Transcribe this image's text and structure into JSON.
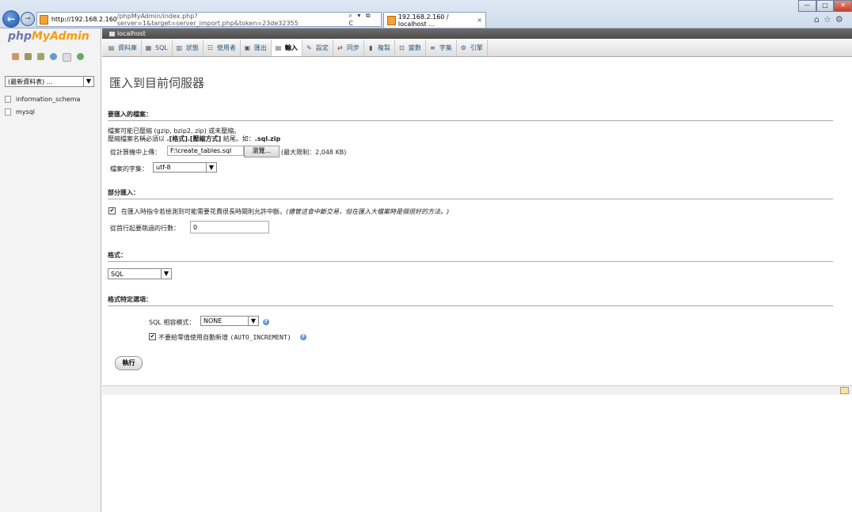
{
  "browser": {
    "url_host": "http://192.168.2.160",
    "url_path": "/phpMyAdmin/index.php?server=1&target=server_import.php&token=23de32355",
    "url_controls": "⌕ ▾ ⧉ C",
    "tab_title": "192.168.2.160 / localhost ...",
    "tab_close": "×",
    "right_icons": "⌂☆⚙"
  },
  "sidebar": {
    "logo_php": "php",
    "logo_myadmin": "MyAdmin",
    "db_select": "(最新資料表) ...",
    "databases": [
      "information_schema",
      "mysql"
    ]
  },
  "server_bar": {
    "label": "localhost"
  },
  "tabs": [
    {
      "label": "資料庫",
      "icon": "database-icon"
    },
    {
      "label": "SQL",
      "icon": "sql-icon"
    },
    {
      "label": "狀態",
      "icon": "status-icon"
    },
    {
      "label": "使用者",
      "icon": "users-icon"
    },
    {
      "label": "匯出",
      "icon": "export-icon"
    },
    {
      "label": "輸入",
      "icon": "import-icon",
      "active": true
    },
    {
      "label": "設定",
      "icon": "settings-icon"
    },
    {
      "label": "同步",
      "icon": "sync-icon"
    },
    {
      "label": "複製",
      "icon": "replication-icon"
    },
    {
      "label": "變數",
      "icon": "variables-icon"
    },
    {
      "label": "字集",
      "icon": "charset-icon"
    },
    {
      "label": "引擎",
      "icon": "engines-icon"
    }
  ],
  "main": {
    "title": "匯入到目前伺服器",
    "file_section": {
      "heading": "要匯入的檔案：",
      "line1": "檔案可能已壓縮 (gzip, bzip2, zip) 或未壓縮。",
      "line2_a": "壓縮檔案名稱必須以 ",
      "line2_b": ".[格式].[壓縮方式]",
      "line2_c": " 結尾。如：",
      "line2_d": ".sql.zip",
      "upload_label": "從計算機中上傳：",
      "upload_value": "F:\\create_tables.sql",
      "browse_label": "瀏覽...",
      "max_size": "(最大限制：2,048 KB)",
      "charset_label": "檔案的字集：",
      "charset_value": "utf-8"
    },
    "partial_section": {
      "heading": "部分匯入：",
      "allow_interrupt": "在匯入時指令若檢測到可能需要花費很長時間則允許中斷。",
      "allow_interrupt_note": "(儘管這會中斷交易，但在匯入大檔案時是個很好的方法。)",
      "allow_interrupt_checked": true,
      "skip_label": "從首行起要跳過的行數：",
      "skip_value": "0"
    },
    "format_section": {
      "heading": "格式：",
      "format_value": "SQL"
    },
    "options_section": {
      "heading": "格式特定選項：",
      "compat_label": "SQL 相容模式：",
      "compat_value": "NONE",
      "no_auto_value": "不要給零值使用自動新增",
      "no_auto_code": "(AUTO_INCREMENT)",
      "no_auto_checked": true
    },
    "go_button": "執行"
  },
  "window_controls": {
    "minimize": "—",
    "maximize": "□",
    "close": "✕"
  }
}
